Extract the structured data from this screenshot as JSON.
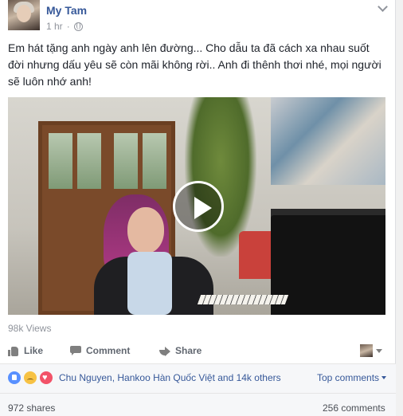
{
  "post": {
    "author": "My Tam",
    "time": "1 hr",
    "text": "Em hát tặng anh ngày anh lên đường... Cho dẫu ta đã cách xa nhau suốt đời nhưng dấu yêu sẽ còn mãi không rời.. Anh đi thênh thơi nhé, mọi người sẽ luôn nhớ anh!"
  },
  "video": {
    "views": "98k Views"
  },
  "actions": {
    "like": "Like",
    "comment": "Comment",
    "share": "Share"
  },
  "footer": {
    "reaction_names": "Chu Nguyen, Hankoo Hàn Quốc Việt and 14k others",
    "top_comments": "Top comments",
    "shares": "972 shares",
    "comments": "256 comments"
  },
  "colors": {
    "link": "#365899",
    "muted": "#90949c",
    "action": "#616770"
  },
  "icons": [
    "globe-icon",
    "chevron-down-icon",
    "play-icon",
    "like-icon",
    "comment-icon",
    "share-icon",
    "caret-icon",
    "reaction-like-icon",
    "reaction-sad-icon",
    "reaction-love-icon"
  ]
}
